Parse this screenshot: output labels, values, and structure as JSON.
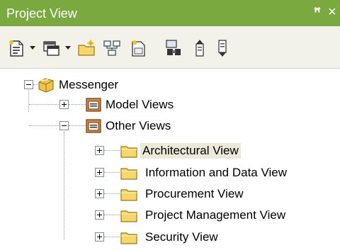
{
  "window": {
    "title": "Project View",
    "pin_glyph": "ꟸ",
    "close_glyph": "×"
  },
  "toolbar": {
    "buttons": [
      {
        "name": "new-diagram-icon",
        "has_dropdown": true
      },
      {
        "name": "new-element-icon",
        "has_dropdown": true
      },
      {
        "name": "new-package-icon"
      },
      {
        "name": "new-view-icon"
      },
      {
        "name": "new-model-icon"
      },
      {
        "name": "find-icon"
      },
      {
        "name": "move-up-icon"
      },
      {
        "name": "move-down-icon"
      }
    ]
  },
  "tree": {
    "root": {
      "label": "Messenger",
      "icon": "root-package-icon",
      "expanded": true
    },
    "model_views": {
      "label": "Model Views",
      "icon": "view-icon",
      "expanded": false
    },
    "other_views": {
      "label": "Other Views",
      "icon": "view-icon",
      "expanded": true
    },
    "children": [
      {
        "label": "Architectural View",
        "icon": "folder-icon",
        "selected": true
      },
      {
        "label": "Information and Data View",
        "icon": "folder-icon"
      },
      {
        "label": "Procurement View",
        "icon": "folder-icon"
      },
      {
        "label": "Project Management View",
        "icon": "folder-icon"
      },
      {
        "label": "Security View",
        "icon": "folder-icon"
      }
    ]
  },
  "colors": {
    "title_bar": "#79a93f",
    "toolbar": "#f2f1ea",
    "selection": "#ece9d8",
    "folder": "#f7d66a"
  }
}
